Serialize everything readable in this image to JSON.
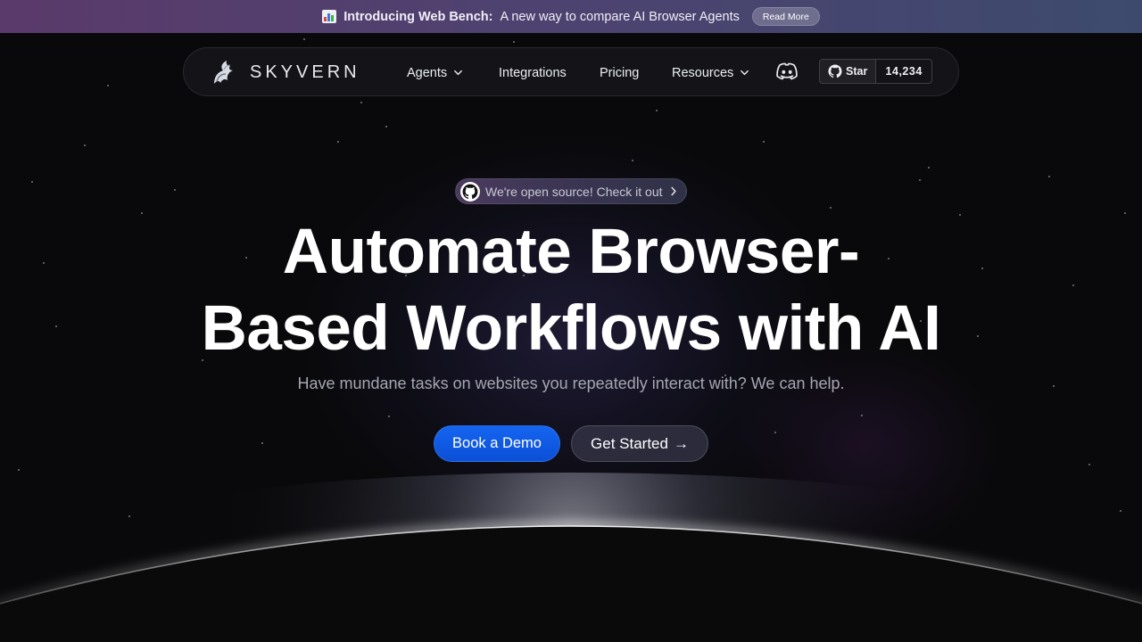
{
  "colors": {
    "background": "#09090b",
    "announce_start": "#5a3a6a",
    "announce_end": "#3d4a6e",
    "primary_button": "#0b4fd6",
    "text_muted": "#a6a7b2"
  },
  "announcement": {
    "icon": "bar-chart-emoji-icon",
    "title": "Introducing Web Bench:",
    "text": "A new way to compare AI Browser Agents",
    "button_label": "Read More"
  },
  "navbar": {
    "brand": {
      "logo_icon": "skyvern-dragon-logo-icon",
      "name": "SKYVERN"
    },
    "links": [
      {
        "label": "Agents",
        "has_dropdown": true
      },
      {
        "label": "Integrations",
        "has_dropdown": false
      },
      {
        "label": "Pricing",
        "has_dropdown": false
      },
      {
        "label": "Resources",
        "has_dropdown": true
      }
    ],
    "discord_icon": "discord-icon",
    "github": {
      "icon": "github-icon",
      "label": "Star",
      "count": "14,234"
    }
  },
  "hero": {
    "pill": {
      "icon": "github-icon",
      "text": "We're open source! Check it out",
      "arrow_icon": "chevron-right-icon"
    },
    "title_line1": "Automate Browser-",
    "title_line2": "Based Workflows with AI",
    "subtitle": "Have mundane tasks on websites you repeatedly interact with? We can help.",
    "primary_button": "Book a Demo",
    "secondary_button": "Get Started",
    "secondary_arrow": "→"
  }
}
